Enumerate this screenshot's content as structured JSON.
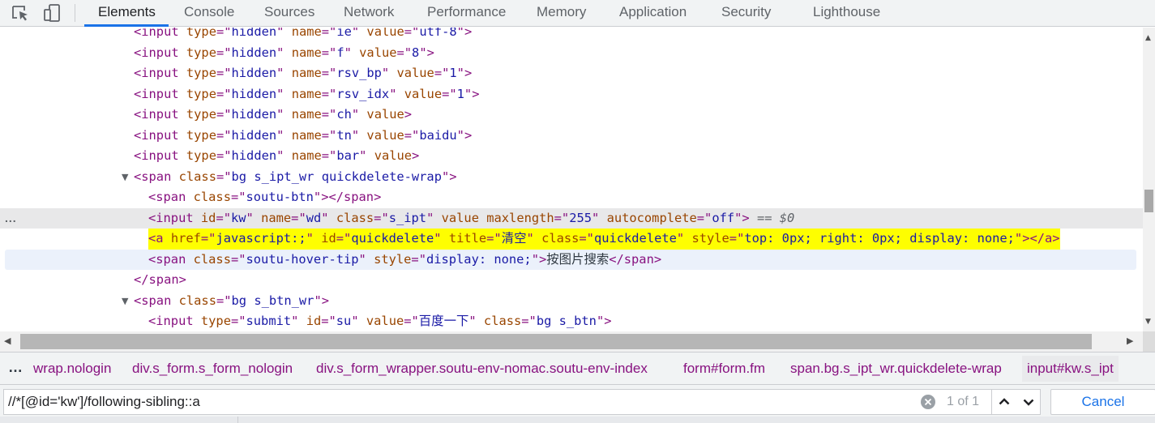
{
  "tabs": [
    {
      "label": "Elements",
      "active": true
    },
    {
      "label": "Console"
    },
    {
      "label": "Sources"
    },
    {
      "label": "Network"
    },
    {
      "label": "Performance"
    },
    {
      "label": "Memory"
    },
    {
      "label": "Application"
    },
    {
      "label": "Security"
    },
    {
      "label": "Lighthouse"
    }
  ],
  "tree": {
    "rows": [
      {
        "kind": "input",
        "parts": [
          [
            "t",
            "<input"
          ],
          [
            "s",
            " "
          ],
          [
            "a",
            "type"
          ],
          [
            "e",
            "=\""
          ],
          [
            "v",
            "hidden"
          ],
          [
            "e",
            "\""
          ],
          [
            "s",
            " "
          ],
          [
            "a",
            "name"
          ],
          [
            "e",
            "=\""
          ],
          [
            "v",
            "ie"
          ],
          [
            "e",
            "\""
          ],
          [
            "s",
            " "
          ],
          [
            "a",
            "value"
          ],
          [
            "e",
            "=\""
          ],
          [
            "v",
            "utf-8"
          ],
          [
            "e",
            "\""
          ],
          [
            "t",
            ">"
          ]
        ]
      },
      {
        "kind": "input",
        "parts": [
          [
            "t",
            "<input"
          ],
          [
            "s",
            " "
          ],
          [
            "a",
            "type"
          ],
          [
            "e",
            "=\""
          ],
          [
            "v",
            "hidden"
          ],
          [
            "e",
            "\""
          ],
          [
            "s",
            " "
          ],
          [
            "a",
            "name"
          ],
          [
            "e",
            "=\""
          ],
          [
            "v",
            "f"
          ],
          [
            "e",
            "\""
          ],
          [
            "s",
            " "
          ],
          [
            "a",
            "value"
          ],
          [
            "e",
            "=\""
          ],
          [
            "v",
            "8"
          ],
          [
            "e",
            "\""
          ],
          [
            "t",
            ">"
          ]
        ]
      },
      {
        "kind": "input",
        "parts": [
          [
            "t",
            "<input"
          ],
          [
            "s",
            " "
          ],
          [
            "a",
            "type"
          ],
          [
            "e",
            "=\""
          ],
          [
            "v",
            "hidden"
          ],
          [
            "e",
            "\""
          ],
          [
            "s",
            " "
          ],
          [
            "a",
            "name"
          ],
          [
            "e",
            "=\""
          ],
          [
            "v",
            "rsv_bp"
          ],
          [
            "e",
            "\""
          ],
          [
            "s",
            " "
          ],
          [
            "a",
            "value"
          ],
          [
            "e",
            "=\""
          ],
          [
            "v",
            "1"
          ],
          [
            "e",
            "\""
          ],
          [
            "t",
            ">"
          ]
        ]
      },
      {
        "kind": "input",
        "parts": [
          [
            "t",
            "<input"
          ],
          [
            "s",
            " "
          ],
          [
            "a",
            "type"
          ],
          [
            "e",
            "=\""
          ],
          [
            "v",
            "hidden"
          ],
          [
            "e",
            "\""
          ],
          [
            "s",
            " "
          ],
          [
            "a",
            "name"
          ],
          [
            "e",
            "=\""
          ],
          [
            "v",
            "rsv_idx"
          ],
          [
            "e",
            "\""
          ],
          [
            "s",
            " "
          ],
          [
            "a",
            "value"
          ],
          [
            "e",
            "=\""
          ],
          [
            "v",
            "1"
          ],
          [
            "e",
            "\""
          ],
          [
            "t",
            ">"
          ]
        ]
      },
      {
        "kind": "input",
        "parts": [
          [
            "t",
            "<input"
          ],
          [
            "s",
            " "
          ],
          [
            "a",
            "type"
          ],
          [
            "e",
            "=\""
          ],
          [
            "v",
            "hidden"
          ],
          [
            "e",
            "\""
          ],
          [
            "s",
            " "
          ],
          [
            "a",
            "name"
          ],
          [
            "e",
            "=\""
          ],
          [
            "v",
            "ch"
          ],
          [
            "e",
            "\""
          ],
          [
            "s",
            " "
          ],
          [
            "a",
            "value"
          ],
          [
            "t",
            ">"
          ]
        ]
      },
      {
        "kind": "input",
        "parts": [
          [
            "t",
            "<input"
          ],
          [
            "s",
            " "
          ],
          [
            "a",
            "type"
          ],
          [
            "e",
            "=\""
          ],
          [
            "v",
            "hidden"
          ],
          [
            "e",
            "\""
          ],
          [
            "s",
            " "
          ],
          [
            "a",
            "name"
          ],
          [
            "e",
            "=\""
          ],
          [
            "v",
            "tn"
          ],
          [
            "e",
            "\""
          ],
          [
            "s",
            " "
          ],
          [
            "a",
            "value"
          ],
          [
            "e",
            "=\""
          ],
          [
            "v",
            "baidu"
          ],
          [
            "e",
            "\""
          ],
          [
            "t",
            ">"
          ]
        ]
      },
      {
        "kind": "input",
        "parts": [
          [
            "t",
            "<input"
          ],
          [
            "s",
            " "
          ],
          [
            "a",
            "type"
          ],
          [
            "e",
            "=\""
          ],
          [
            "v",
            "hidden"
          ],
          [
            "e",
            "\""
          ],
          [
            "s",
            " "
          ],
          [
            "a",
            "name"
          ],
          [
            "e",
            "=\""
          ],
          [
            "v",
            "bar"
          ],
          [
            "e",
            "\""
          ],
          [
            "s",
            " "
          ],
          [
            "a",
            "value"
          ],
          [
            "t",
            ">"
          ]
        ]
      },
      {
        "kind": "span-open",
        "expander": "▼",
        "parts": [
          [
            "t",
            "<span"
          ],
          [
            "s",
            " "
          ],
          [
            "a",
            "class"
          ],
          [
            "e",
            "=\""
          ],
          [
            "v",
            "bg s_ipt_wr quickdelete-wrap"
          ],
          [
            "e",
            "\""
          ],
          [
            "t",
            ">"
          ]
        ]
      },
      {
        "kind": "span",
        "parts": [
          [
            "t",
            "<span"
          ],
          [
            "s",
            " "
          ],
          [
            "a",
            "class"
          ],
          [
            "e",
            "=\""
          ],
          [
            "v",
            "soutu-btn"
          ],
          [
            "e",
            "\""
          ],
          [
            "t",
            "></span>"
          ]
        ]
      },
      {
        "kind": "input-selected",
        "selected": true,
        "gutter": "...",
        "parts": [
          [
            "t",
            "<input"
          ],
          [
            "s",
            " "
          ],
          [
            "a",
            "id"
          ],
          [
            "e",
            "=\""
          ],
          [
            "v",
            "kw"
          ],
          [
            "e",
            "\""
          ],
          [
            "s",
            " "
          ],
          [
            "a",
            "name"
          ],
          [
            "e",
            "=\""
          ],
          [
            "v",
            "wd"
          ],
          [
            "e",
            "\""
          ],
          [
            "s",
            " "
          ],
          [
            "a",
            "class"
          ],
          [
            "e",
            "=\""
          ],
          [
            "v",
            "s_ipt"
          ],
          [
            "e",
            "\""
          ],
          [
            "s",
            " "
          ],
          [
            "a",
            "value"
          ],
          [
            "s",
            " "
          ],
          [
            "a",
            "maxlength"
          ],
          [
            "e",
            "=\""
          ],
          [
            "v",
            "255"
          ],
          [
            "e",
            "\""
          ],
          [
            "s",
            " "
          ],
          [
            "a",
            "autocomplete"
          ],
          [
            "e",
            "=\""
          ],
          [
            "v",
            "off"
          ],
          [
            "e",
            "\""
          ],
          [
            "t",
            ">"
          ],
          [
            "x",
            " == "
          ],
          [
            "d",
            "$0"
          ]
        ]
      },
      {
        "kind": "a",
        "highlight": true,
        "parts": [
          [
            "t",
            "<a"
          ],
          [
            "s",
            " "
          ],
          [
            "a",
            "href"
          ],
          [
            "e",
            "=\""
          ],
          [
            "v",
            "javascript:;"
          ],
          [
            "e",
            "\""
          ],
          [
            "s",
            " "
          ],
          [
            "a",
            "id"
          ],
          [
            "e",
            "=\""
          ],
          [
            "v",
            "quickdelete"
          ],
          [
            "e",
            "\""
          ],
          [
            "s",
            " "
          ],
          [
            "a",
            "title"
          ],
          [
            "e",
            "=\""
          ],
          [
            "v",
            "清空"
          ],
          [
            "e",
            "\""
          ],
          [
            "s",
            " "
          ],
          [
            "a",
            "class"
          ],
          [
            "e",
            "=\""
          ],
          [
            "v",
            "quickdelete"
          ],
          [
            "e",
            "\""
          ],
          [
            "s",
            " "
          ],
          [
            "a",
            "style"
          ],
          [
            "e",
            "=\""
          ],
          [
            "v",
            "top: 0px; right: 0px; display: none;"
          ],
          [
            "e",
            "\""
          ],
          [
            "t",
            "></a>"
          ]
        ]
      },
      {
        "kind": "span-hover",
        "hover": true,
        "parts": [
          [
            "t",
            "<span"
          ],
          [
            "s",
            " "
          ],
          [
            "a",
            "class"
          ],
          [
            "e",
            "=\""
          ],
          [
            "v",
            "soutu-hover-tip"
          ],
          [
            "e",
            "\""
          ],
          [
            "s",
            " "
          ],
          [
            "a",
            "style"
          ],
          [
            "e",
            "=\""
          ],
          [
            "v",
            "display: none;"
          ],
          [
            "e",
            "\""
          ],
          [
            "t",
            ">"
          ],
          [
            "c",
            "按图片搜索"
          ],
          [
            "t",
            "</span>"
          ]
        ]
      },
      {
        "kind": "span-close",
        "parts": [
          [
            "t",
            "</span>"
          ]
        ]
      },
      {
        "kind": "span-open",
        "expander": "▼",
        "parts": [
          [
            "t",
            "<span"
          ],
          [
            "s",
            " "
          ],
          [
            "a",
            "class"
          ],
          [
            "e",
            "=\""
          ],
          [
            "v",
            "bg s_btn_wr"
          ],
          [
            "e",
            "\""
          ],
          [
            "t",
            ">"
          ]
        ]
      },
      {
        "kind": "input",
        "parts": [
          [
            "t",
            "<input"
          ],
          [
            "s",
            " "
          ],
          [
            "a",
            "type"
          ],
          [
            "e",
            "=\""
          ],
          [
            "v",
            "submit"
          ],
          [
            "e",
            "\""
          ],
          [
            "s",
            " "
          ],
          [
            "a",
            "id"
          ],
          [
            "e",
            "=\""
          ],
          [
            "v",
            "su"
          ],
          [
            "e",
            "\""
          ],
          [
            "s",
            " "
          ],
          [
            "a",
            "value"
          ],
          [
            "e",
            "=\""
          ],
          [
            "v",
            "百度一下"
          ],
          [
            "e",
            "\""
          ],
          [
            "s",
            " "
          ],
          [
            "a",
            "class"
          ],
          [
            "e",
            "=\""
          ],
          [
            "v",
            "bg s_btn"
          ],
          [
            "e",
            "\""
          ],
          [
            "t",
            ">"
          ]
        ]
      }
    ]
  },
  "breadcrumbs": {
    "more": "…",
    "items": [
      "wrap.nologin",
      "div.s_form.s_form_nologin",
      "div.s_form_wrapper.soutu-env-nomac.soutu-env-index",
      "form#form.fm",
      "span.bg.s_ipt_wr.quickdelete-wrap",
      "input#kw.s_ipt"
    ]
  },
  "search": {
    "query": "//*[@id='kw']/following-sibling::a",
    "match_count": "1 of 1",
    "cancel_label": "Cancel"
  },
  "icons": {
    "inspect": "inspect-element-icon",
    "device": "device-toolbar-icon",
    "clear": "clear-search-icon",
    "prev": "chevron-up-icon",
    "next": "chevron-down-icon"
  },
  "colors": {
    "tag": "#881280",
    "attr_name": "#994500",
    "attr_value": "#1a1aa6",
    "highlight": "#fefe00",
    "selected_row": "#e8e8e9",
    "accent": "#1a73e8"
  }
}
